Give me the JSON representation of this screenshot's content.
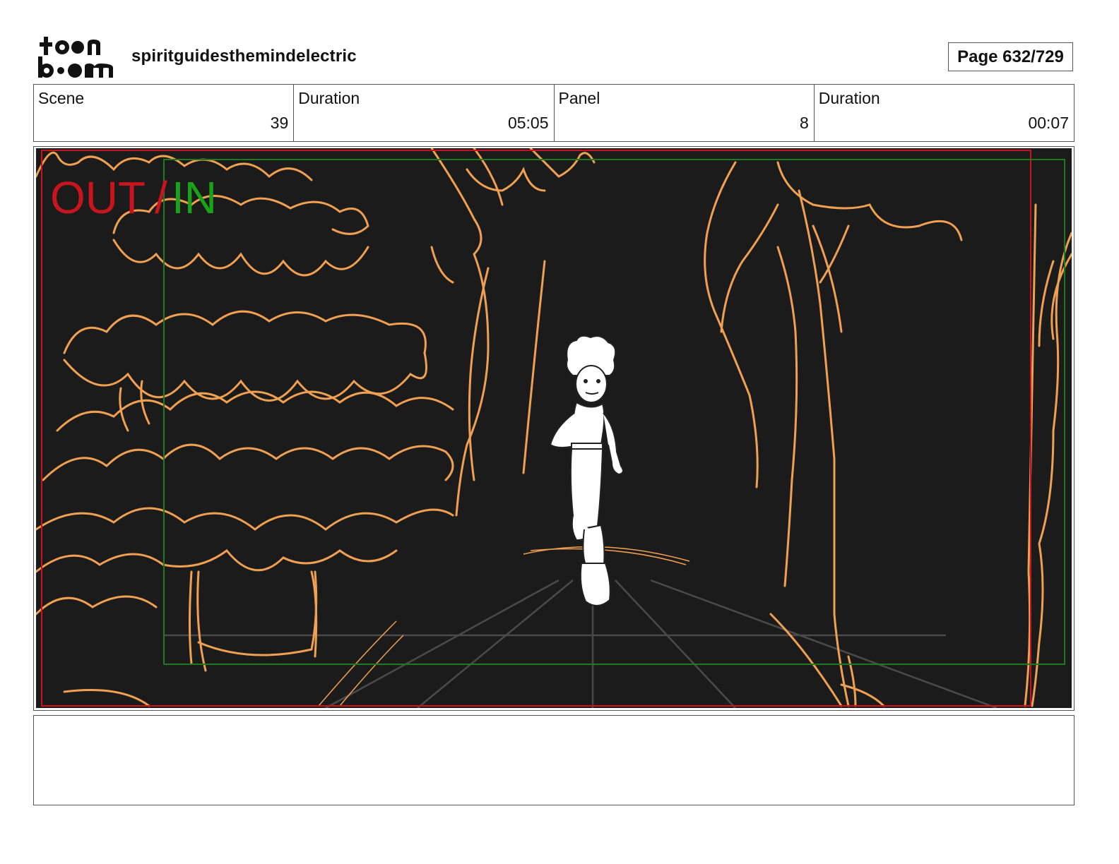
{
  "header": {
    "logo_text": "toon boom",
    "project_title": "spiritguidesthemindelectric",
    "page_indicator": "Page 632/729"
  },
  "info_table": [
    {
      "label": "Scene",
      "value": "39"
    },
    {
      "label": "Duration",
      "value": "05:05"
    },
    {
      "label": "Panel",
      "value": "8"
    },
    {
      "label": "Duration",
      "value": "00:07"
    }
  ],
  "panel": {
    "out_label": "OUT",
    "separator": "/",
    "in_label": "IN",
    "colors": {
      "background": "#1b1b1b",
      "sketch": "#f0a052",
      "character": "#ffffff",
      "outer_frame": "#c8141e",
      "safe_frame": "#1f7a1f",
      "perspective_grid": "#4a4a4a"
    }
  },
  "dialogue": {
    "text": ""
  }
}
